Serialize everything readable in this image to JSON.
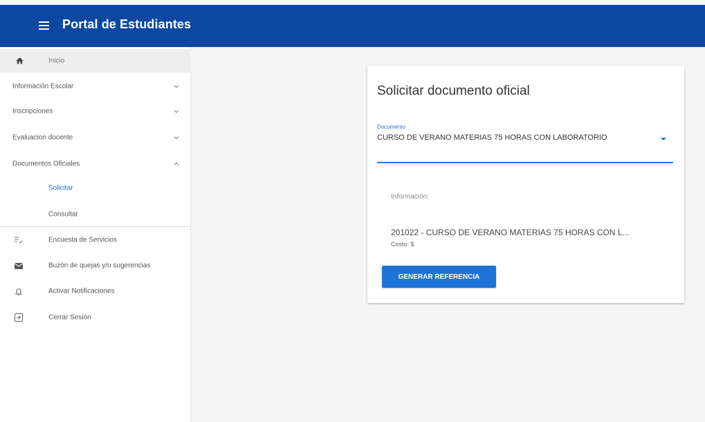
{
  "header": {
    "title": "Portal de Estudiantes",
    "menu_icon": "hamburger-menu-icon",
    "bg_color": "#0d47a1"
  },
  "sidebar": {
    "home": {
      "label": "Inicio",
      "icon": "home-icon"
    },
    "sections": [
      {
        "label": "Información Escolar",
        "expanded": false
      },
      {
        "label": "Inscripciones",
        "expanded": false
      },
      {
        "label": "Evaluacion docente",
        "expanded": false
      },
      {
        "label": "Documentos Oficiales",
        "expanded": true
      }
    ],
    "subitems": [
      {
        "label": "Solicitar",
        "selected": true
      },
      {
        "label": "Consultar",
        "selected": false
      }
    ],
    "links": [
      {
        "label": "Encuesta de Servicios",
        "icon": "survey-icon"
      },
      {
        "label": "Buzón de quejas y/o sugerencias",
        "icon": "mail-icon"
      },
      {
        "label": "Activar Notificaciones",
        "icon": "bell-icon"
      },
      {
        "label": "Cerrar Sesión",
        "icon": "logout-icon"
      }
    ]
  },
  "card": {
    "title": "Solicitar documento oficial",
    "field_label": "Documento",
    "field_value": "CURSO DE VERANO MATERIAS 75 HORAS CON LABORATORIO",
    "info_label": "Información:",
    "info_document": "201022 - CURSO DE VERANO MATERIAS 75 HORAS CON L...",
    "info_cost": "Costo: $",
    "button_label": "GENERAR REFERENCIA",
    "accent_color": "#1e73d6"
  }
}
